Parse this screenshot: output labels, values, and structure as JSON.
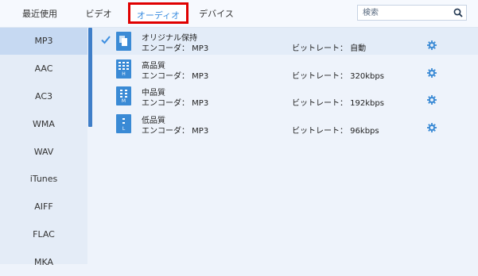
{
  "tabs": [
    "最近使用",
    "ビデオ",
    "オーディオ",
    "デバイス"
  ],
  "search": {
    "placeholder": "検索"
  },
  "sidebar": {
    "items": [
      "MP3",
      "AAC",
      "AC3",
      "WMA",
      "WAV",
      "iTunes",
      "AIFF",
      "FLAC",
      "MKA"
    ],
    "active": "MP3"
  },
  "presets": [
    {
      "name": "オリジナル保持",
      "encoder": "エンコーダ：  MP3",
      "bitrate": "ビットレート：  自動",
      "level": "",
      "selected": true
    },
    {
      "name": "高品質",
      "encoder": "エンコーダ：  MP3",
      "bitrate": "ビットレート：  320kbps",
      "level": "H",
      "selected": false
    },
    {
      "name": "中品質",
      "encoder": "エンコーダ：  MP3",
      "bitrate": "ビットレート：  192kbps",
      "level": "M",
      "selected": false
    },
    {
      "name": "低品質",
      "encoder": "エンコーダ：  MP3",
      "bitrate": "ビットレート：  96kbps",
      "level": "L",
      "selected": false
    }
  ],
  "colors": {
    "accent": "#3c8ee0",
    "highlight_box": "#e00000",
    "icon_blue": "#3a8ad5",
    "scrollbar": "#3f7ec8"
  }
}
